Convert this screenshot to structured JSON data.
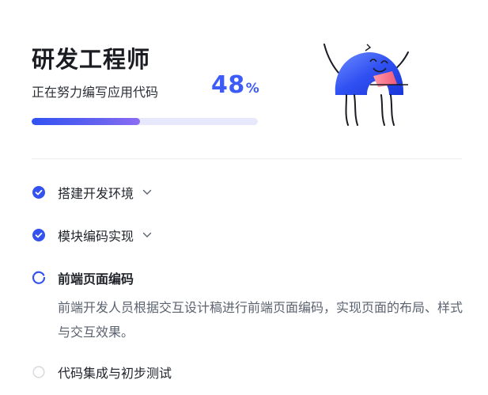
{
  "header": {
    "title": "研发工程师",
    "subtitle": "正在努力编写应用代码",
    "percent_value": "48",
    "percent_sign": "%",
    "progress": 0.48
  },
  "steps": [
    {
      "label": "搭建开发环境",
      "status": "done",
      "icon": "check-circle-icon",
      "expandable": true
    },
    {
      "label": "模块编码实现",
      "status": "done",
      "icon": "check-circle-icon",
      "expandable": true
    },
    {
      "label": "前端页面编码",
      "status": "in-progress",
      "icon": "spinner-icon",
      "expandable": false,
      "description": "前端开发人员根据交互设计稿进行前端页面编码，实现页面的布局、样式与交互效果。"
    },
    {
      "label": "代码集成与初步测试",
      "status": "pending",
      "icon": "empty-circle-icon",
      "expandable": false
    }
  ],
  "colors": {
    "accent": "#3d5bf6",
    "check": "#3452f0",
    "pending": "#d9dbe0",
    "track": "#e7e8fb"
  }
}
